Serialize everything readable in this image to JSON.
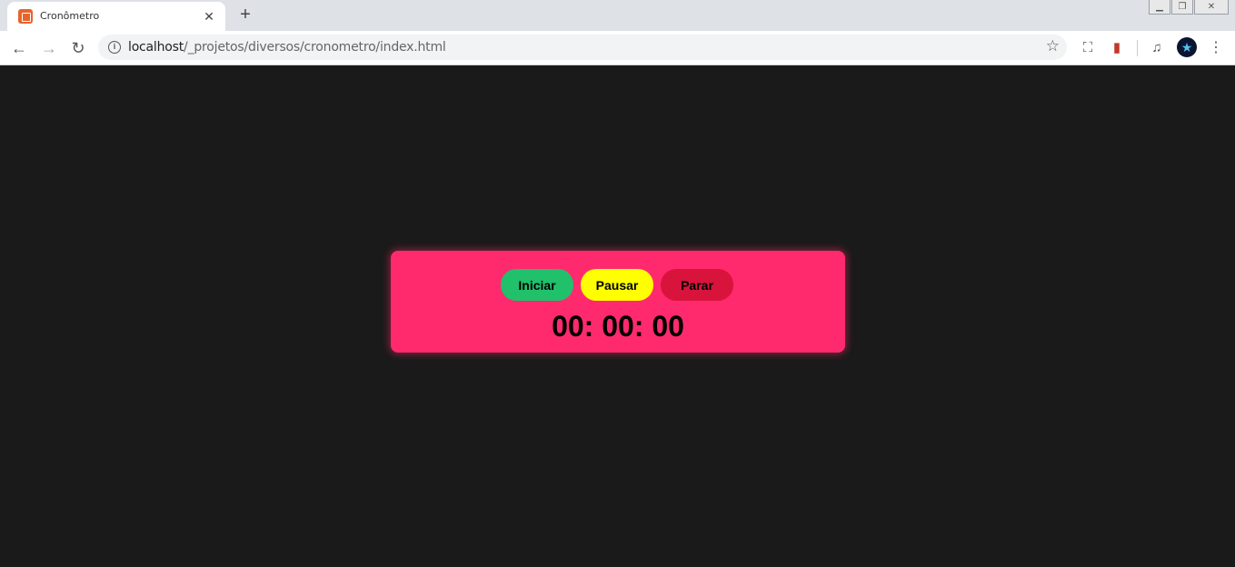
{
  "browser": {
    "tab": {
      "title": "Cronômetro",
      "favicon": "xampp-icon"
    },
    "new_tab_icon": "+",
    "close_icon": "✕",
    "url": {
      "host": "localhost",
      "path": "/_projetos/diversos/cronometro/index.html"
    }
  },
  "page": {
    "buttons": {
      "start": {
        "label": "Iniciar",
        "color": "#21c06b"
      },
      "pause": {
        "label": "Pausar",
        "color": "#ffff00"
      },
      "stop": {
        "label": "Parar",
        "color": "#d8143c"
      }
    },
    "timer": "00: 00: 00",
    "card_color": "#ff2a6d",
    "background": "#1a1a1a"
  }
}
